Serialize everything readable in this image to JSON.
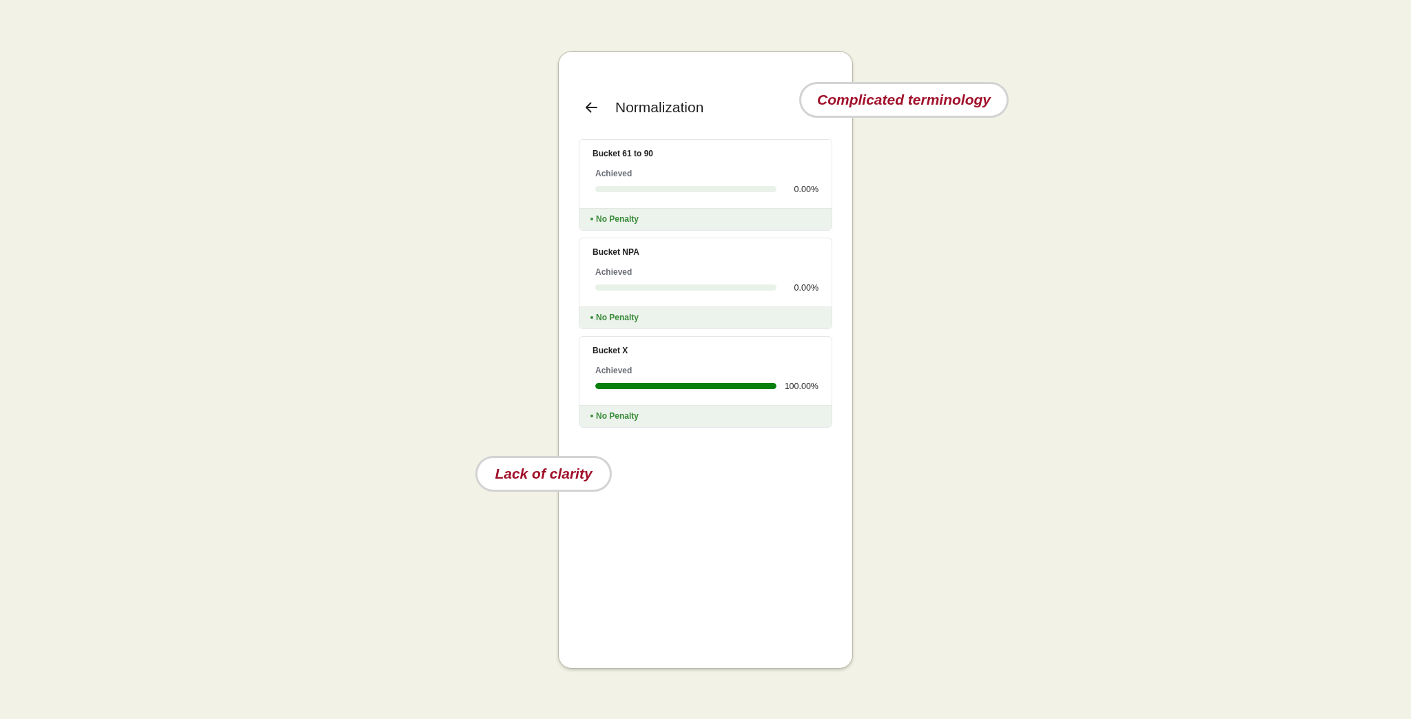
{
  "screen": {
    "title": "Normalization"
  },
  "buckets": [
    {
      "name": "Bucket 61 to 90",
      "label": "Achieved",
      "level": 0,
      "reading": "0.00%",
      "status": "No Penalty"
    },
    {
      "name": "Bucket NPA",
      "label": "Achieved",
      "level": 0,
      "reading": "0.00%",
      "status": "No Penalty"
    },
    {
      "name": "Bucket X",
      "label": "Achieved",
      "level": 1,
      "reading": "100.00%",
      "status": "No Penalty"
    }
  ],
  "annotations": [
    {
      "text": "Complicated terminology"
    },
    {
      "text": "Lack of clarity"
    }
  ]
}
